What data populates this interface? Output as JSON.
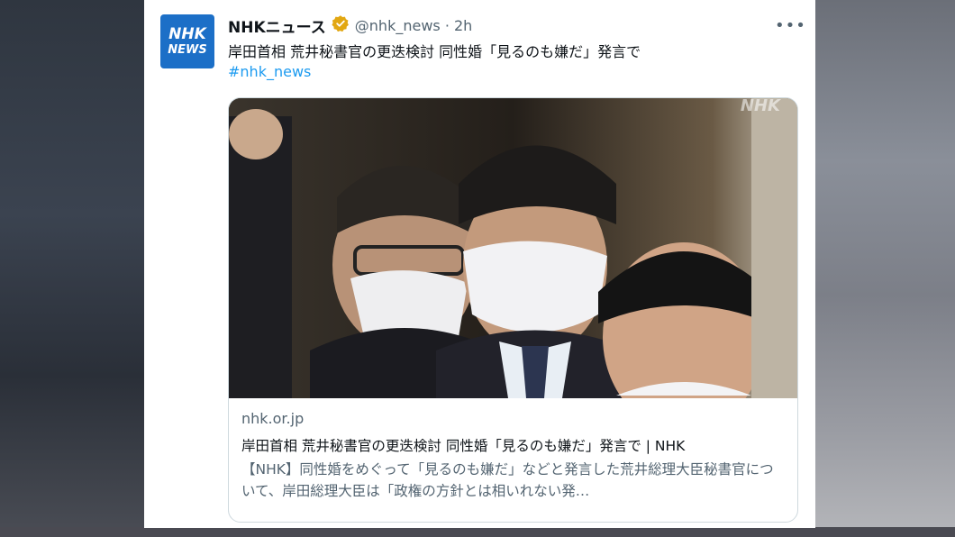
{
  "account": {
    "avatar_line1": "NHK",
    "avatar_line2": "NEWS",
    "display_name": "NHKニュース",
    "handle": "@nhk_news · 2h",
    "verified": true
  },
  "tweet": {
    "text": "岸田首相 荒井秘書官の更迭検討 同性婚「見るのも嫌だ」発言で",
    "hashtag": "#nhk_news",
    "more_icon": "more-horizontal-icon"
  },
  "card": {
    "photo_watermark": "NHK",
    "domain": "nhk.or.jp",
    "title": "岸田首相 荒井秘書官の更迭検討 同性婚「見るのも嫌だ」発言で | NHK",
    "description": "【NHK】同性婚をめぐって「見るのも嫌だ」などと発言した荒井総理大臣秘書官について、岸田総理大臣は「政権の方針とは相いれない発…"
  },
  "colors": {
    "brand_blue": "#1c6fc7",
    "link_blue": "#1d9bf0",
    "verified_gold": "#e2a711"
  }
}
